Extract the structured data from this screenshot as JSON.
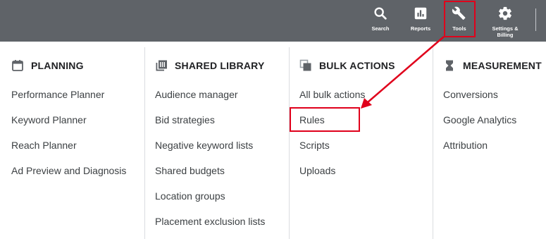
{
  "topbar": {
    "buttons": [
      {
        "label": "Search",
        "icon": "search-icon"
      },
      {
        "label": "Reports",
        "icon": "reports-icon"
      },
      {
        "label": "Tools",
        "icon": "wrench-icon"
      },
      {
        "label": "Settings &\nBilling",
        "icon": "gear-icon"
      }
    ]
  },
  "columns": [
    {
      "title": "PLANNING",
      "icon": "calendar-icon",
      "items": [
        "Performance Planner",
        "Keyword Planner",
        "Reach Planner",
        "Ad Preview and Diagnosis"
      ]
    },
    {
      "title": "SHARED LIBRARY",
      "icon": "library-icon",
      "items": [
        "Audience manager",
        "Bid strategies",
        "Negative keyword lists",
        "Shared budgets",
        "Location groups",
        "Placement exclusion lists"
      ]
    },
    {
      "title": "BULK ACTIONS",
      "icon": "copy-icon",
      "items": [
        "All bulk actions",
        "Rules",
        "Scripts",
        "Uploads"
      ]
    },
    {
      "title": "MEASUREMENT",
      "icon": "hourglass-icon",
      "items": [
        "Conversions",
        "Google Analytics",
        "Attribution"
      ]
    }
  ],
  "annotations": {
    "highlight_color": "#e0001b"
  },
  "colors": {
    "topbar_bg": "#5f6368",
    "text": "#3c4043",
    "header_text": "#202124"
  }
}
